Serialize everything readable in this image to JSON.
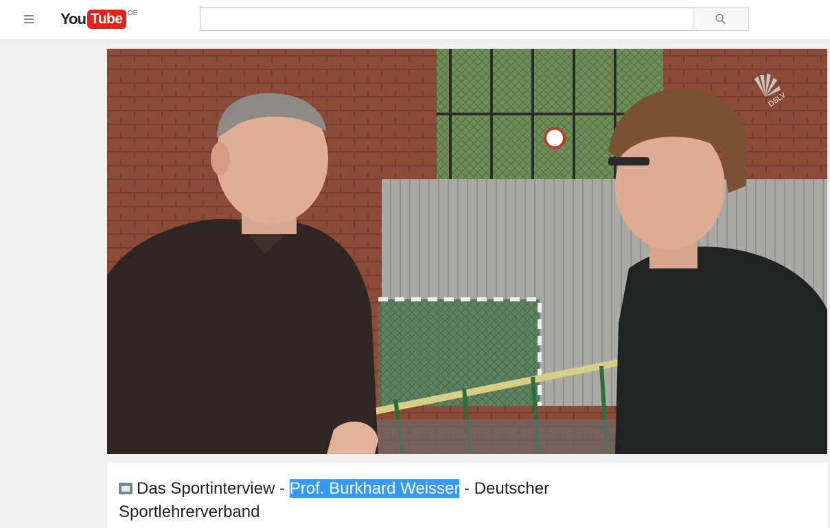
{
  "masthead": {
    "logo": {
      "you": "You",
      "tube": "Tube",
      "country": "DE"
    },
    "search": {
      "value": "",
      "placeholder": ""
    }
  },
  "player": {
    "watermark_text": "DSLV"
  },
  "video": {
    "title_before": "Das Sportinterview - ",
    "title_highlight": "Prof. Burkhard Weisser",
    "title_after": " - Deutscher Sportlehrerverband"
  },
  "colors": {
    "brand_red": "#e62117",
    "selection": "#3399ff",
    "page_bg": "#f1f1f1"
  }
}
